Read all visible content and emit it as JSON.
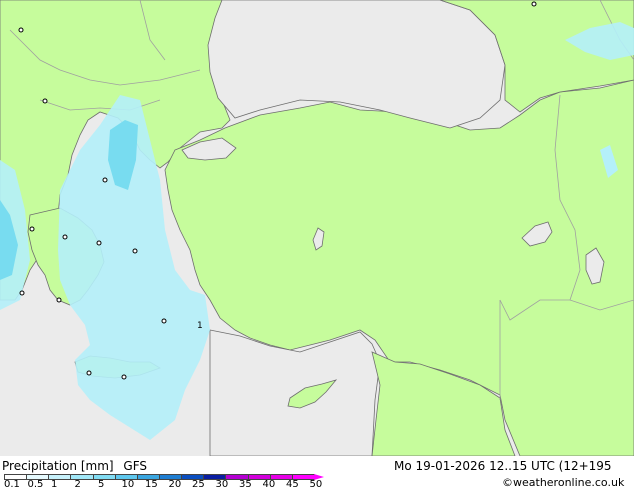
{
  "colors": {
    "sea": "#ebebeb",
    "land": "#c6fc9c",
    "border": "#a0a0a0",
    "coast": "#6e6e6e",
    "precip_light": "#b4f0fa",
    "precip_mid": "#96e6f5",
    "precip_heavy": "#78dcf0"
  },
  "footer": {
    "title": "Precipitation [mm]",
    "model": "GFS",
    "datetime": "Mo 19-01-2026 12..15 UTC (12+195",
    "credit": "©weatheronline.co.uk"
  },
  "scale": {
    "labels": [
      "0.1",
      "0.5",
      "1",
      "2",
      "5",
      "10",
      "15",
      "20",
      "25",
      "30",
      "35",
      "40",
      "45",
      "50"
    ],
    "colors": [
      "#fefefe",
      "#e6fafe",
      "#c8f2fc",
      "#a2e8f8",
      "#82ddf4",
      "#5fc8ee",
      "#3aa6e0",
      "#1f7ed2",
      "#0a4ec0",
      "#0a1ea2",
      "#b400d2",
      "#d200dc",
      "#e600e6",
      "#ff00ff"
    ]
  },
  "map": {
    "point_label": "1"
  }
}
